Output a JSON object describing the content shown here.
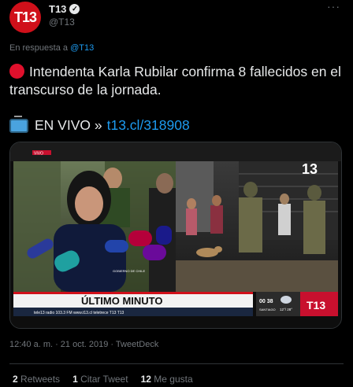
{
  "author": {
    "avatar_text": "T13",
    "name": "T13",
    "handle": "@T13",
    "verified": true
  },
  "more_label": "···",
  "reply": {
    "prefix": "En respuesta a",
    "handle": "@T13"
  },
  "tweet_text": "Intendenta Karla Rubilar confirma 8 fallecidos en el transcurso de la jornada.",
  "live": {
    "text": "EN VIVO »",
    "link": "t13.cl/318908"
  },
  "media": {
    "tag_live": "VIVO",
    "logo_small": "13",
    "banner": "ÚLTIMO MINUTO",
    "ticker": "tele13 radio 103.3 FM   www.t13.cl   teletrece   T13   T13",
    "time": "00 38",
    "place": "SANTIAGO",
    "temp": "12°/ 28°",
    "logo_big": "T13",
    "mic_label": "GOBIERNO DE CHILE"
  },
  "timestamp": "12:40 a. m. · 21 oct. 2019 · TweetDeck",
  "stats": [
    {
      "count": "2",
      "label": "Retweets"
    },
    {
      "count": "1",
      "label": "Citar Tweet"
    },
    {
      "count": "12",
      "label": "Me gusta"
    }
  ]
}
